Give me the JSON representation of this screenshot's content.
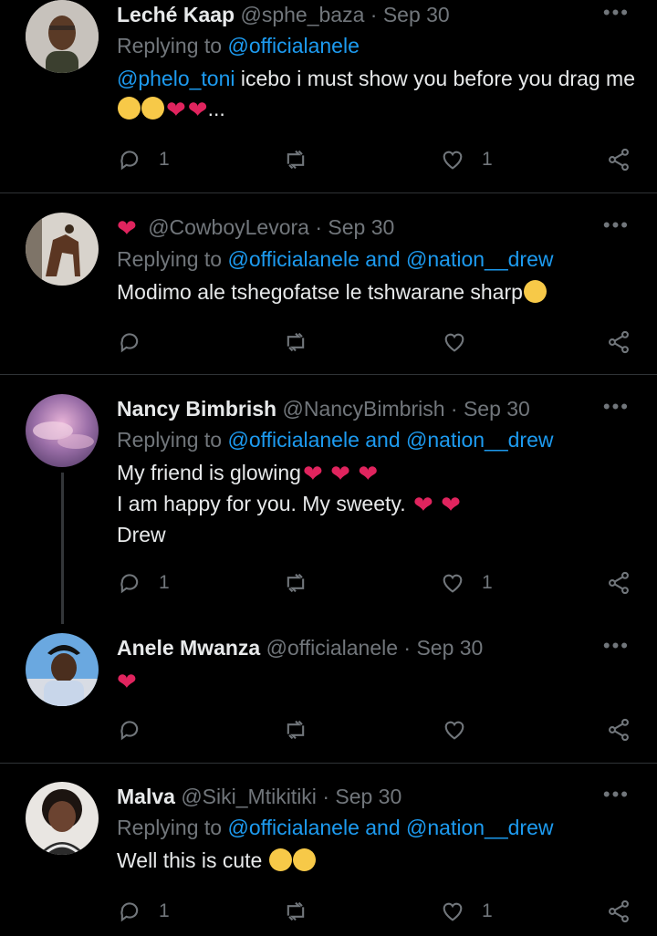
{
  "tweets": [
    {
      "name": "Leché Kaap",
      "handle": "@sphe_baza",
      "date": "· Sep 30",
      "replying_prefix": "Replying to",
      "replying_to": "@officialanele",
      "replying_and": "",
      "replying_to2": "",
      "mention": "@phelo_toni",
      "text": " icebo i must show you before you drag me",
      "suffix": "...",
      "reply_count": "1",
      "like_count": "1"
    },
    {
      "name": "",
      "handle": "@CowboyLevora",
      "date": "· Sep 30",
      "replying_prefix": "Replying to",
      "replying_to": "@officialanele",
      "replying_and": "and",
      "replying_to2": "@nation__drew",
      "text": "Modimo ale tshegofatse le tshwarane sharp",
      "reply_count": "",
      "like_count": ""
    },
    {
      "name": "Nancy Bimbrish",
      "handle": "@NancyBimbrish",
      "date": "· Sep 30",
      "replying_prefix": "Replying to",
      "replying_to": "@officialanele",
      "replying_and": "and",
      "replying_to2": "@nation__drew",
      "line1": "My friend is glowing",
      "line2": "I am happy for you. My sweety.",
      "line3": "Drew",
      "reply_count": "1",
      "like_count": "1"
    },
    {
      "name": "Anele Mwanza",
      "handle": "@officialanele",
      "date": "· Sep 30",
      "reply_count": "",
      "like_count": ""
    },
    {
      "name": "Malva",
      "handle": "@Siki_Mtikitiki",
      "date": "· Sep 30",
      "replying_prefix": "Replying to",
      "replying_to": "@officialanele",
      "replying_and": "and",
      "replying_to2": "@nation__drew",
      "text": "Well this is cute",
      "reply_count": "1",
      "like_count": "1"
    }
  ],
  "icons": {
    "more": "more-icon",
    "reply": "reply-icon",
    "retweet": "retweet-icon",
    "like": "heart-icon",
    "share": "share-icon"
  },
  "colors": {
    "background": "#000000",
    "text": "#e7e9ea",
    "muted": "#71767b",
    "link": "#1d9bf0",
    "heart": "#e0245e",
    "separator": "#2f3336"
  }
}
